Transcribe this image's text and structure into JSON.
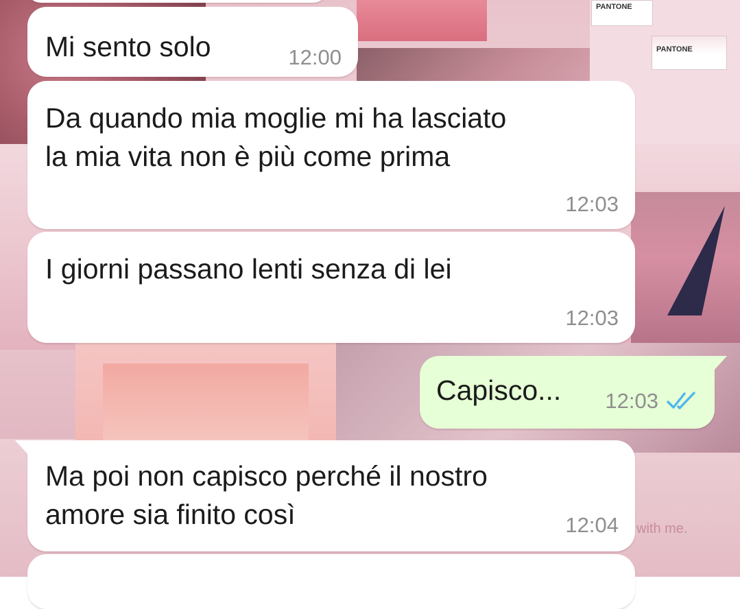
{
  "wallpaper": {
    "pantone_1": "PANTONE",
    "pantone_2": "PANTONE",
    "corner_text": "with me."
  },
  "messages": [
    {
      "direction": "incoming",
      "text": "",
      "time": ""
    },
    {
      "direction": "incoming",
      "text": "Mi sento solo",
      "time": "12:00"
    },
    {
      "direction": "incoming",
      "text": "Da quando mia moglie mi ha lasciato\nla mia vita non è più come prima",
      "time": "12:03"
    },
    {
      "direction": "incoming",
      "text": "I giorni passano lenti senza di lei",
      "time": "12:03"
    },
    {
      "direction": "outgoing",
      "text": "Capisco...",
      "time": "12:03",
      "status_icon": "double-check-icon",
      "status_color": "#4fb6ec"
    },
    {
      "direction": "incoming",
      "text": "Ma poi non capisco perché il nostro\namore sia finito così",
      "time": "12:04"
    },
    {
      "direction": "incoming",
      "text": "",
      "time": ""
    }
  ]
}
